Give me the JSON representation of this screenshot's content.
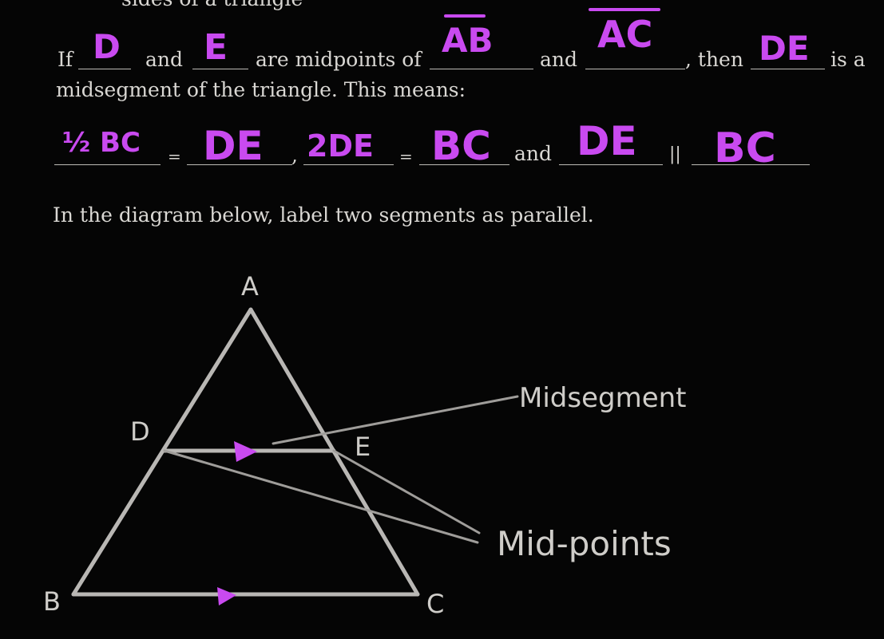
{
  "header_fragment": "sides of a triangle",
  "sentence1": {
    "part_if": "If",
    "part_and1": "and",
    "part_are_midpoints": "are midpoints of",
    "part_and2": "and",
    "part_then": ", then",
    "part_is_a": "is a",
    "line2": "midsegment of the triangle. This means:"
  },
  "answers1": {
    "point1": "D",
    "point2": "E",
    "side1": "AB",
    "side2": "AC",
    "midsegment": "DE"
  },
  "equations": {
    "eq1_sign": "=",
    "comma": ",",
    "eq2_sign": "=",
    "and": "and",
    "parallel": "||",
    "answers": {
      "a1": "½ BC",
      "a2": "DE",
      "a3": "2DE",
      "a4": "BC",
      "a5": "DE",
      "a6": "BC"
    }
  },
  "instruction": "In the diagram below, label two segments as parallel.",
  "diagram": {
    "vertices": {
      "A": "A",
      "B": "B",
      "C": "C",
      "D": "D",
      "E": "E"
    },
    "callouts": {
      "midsegment": "Midsegment",
      "midpoints": "Mid-points"
    },
    "annotation_color": "#c94af0",
    "line_color": "#b9b7b4"
  }
}
